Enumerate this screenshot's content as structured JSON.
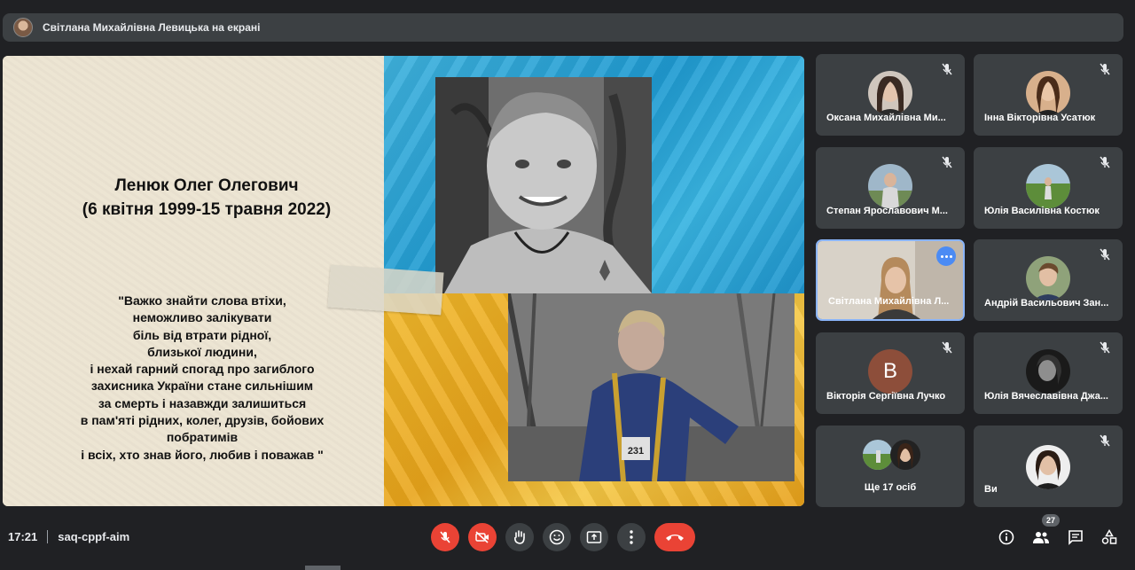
{
  "presenter_banner": {
    "text": "Світлана Михайлівна Левицька на екрані"
  },
  "slide": {
    "title_line1": "Ленюк Олег Олегович",
    "title_line2": "(6 квітня 1999-15 травня 2022)",
    "quote_lines": [
      "\"Важко знайти слова втіхи,",
      "неможливо залікувати",
      "біль від втрати рідної,",
      "близької людини,",
      "і нехай гарний спогад про загиблого",
      "захисника України стане сильнішим",
      "за смерть і назавжди залишиться",
      "в пам'яті рідних, колег, друзів, бойових",
      "побратимів",
      "і всіх, хто знав його, любив і поважав \""
    ],
    "bib_number": "231"
  },
  "participants": [
    {
      "name": "Оксана Михайлівна Ми...",
      "muted": true
    },
    {
      "name": "Інна Вікторівна Усатюк",
      "muted": true
    },
    {
      "name": "Степан Ярославович М...",
      "muted": true
    },
    {
      "name": "Юлія Василівна Костюк",
      "muted": true
    },
    {
      "name": "Світлана Михайлівна Л...",
      "muted": false,
      "active": true
    },
    {
      "name": "Андрій Васильович Зан...",
      "muted": true
    },
    {
      "name": "Вікторія Сергіївна Лучко",
      "muted": true,
      "avatar_letter": "B"
    },
    {
      "name": "Юлія Вячеславівна Джа...",
      "muted": true
    },
    {
      "name": "Ще 17 осіб"
    },
    {
      "name": "Ви",
      "muted": true
    }
  ],
  "bottom_bar": {
    "time": "17:21",
    "meeting_code": "saq-cppf-aim",
    "participants_count": "27",
    "controls": [
      "mic-off",
      "camera-off",
      "raise-hand",
      "emoji",
      "present",
      "more",
      "hang-up"
    ],
    "right_icons": [
      "info",
      "people",
      "chat",
      "activities"
    ]
  },
  "colors": {
    "red": "#ea4335",
    "active_border": "#8ab4f8",
    "tile_bg": "#3c4043",
    "bg": "#202124"
  }
}
